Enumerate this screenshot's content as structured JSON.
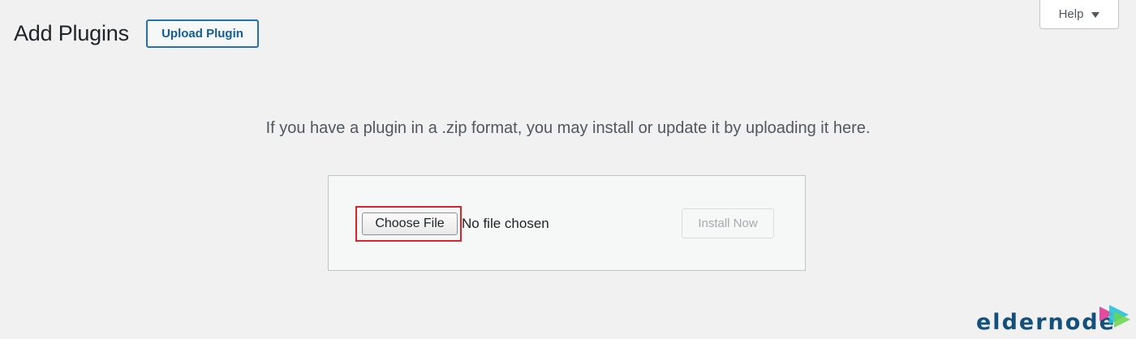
{
  "header": {
    "title": "Add Plugins",
    "upload_button_label": "Upload Plugin",
    "help_tab_label": "Help"
  },
  "upload": {
    "help_text": "If you have a plugin in a .zip format, you may install or update it by uploading it here.",
    "choose_file_label": "Choose File",
    "file_status": "No file chosen",
    "install_button_label": "Install Now"
  },
  "watermark": {
    "brand": "eldernode"
  },
  "colors": {
    "background": "#f1f1f1",
    "accent": "#2271b1",
    "highlight": "#d9232d",
    "brand": "#14517a"
  },
  "icons": {
    "help_caret": "caret-down-icon",
    "brand_mark": "play-arrows-icon"
  }
}
